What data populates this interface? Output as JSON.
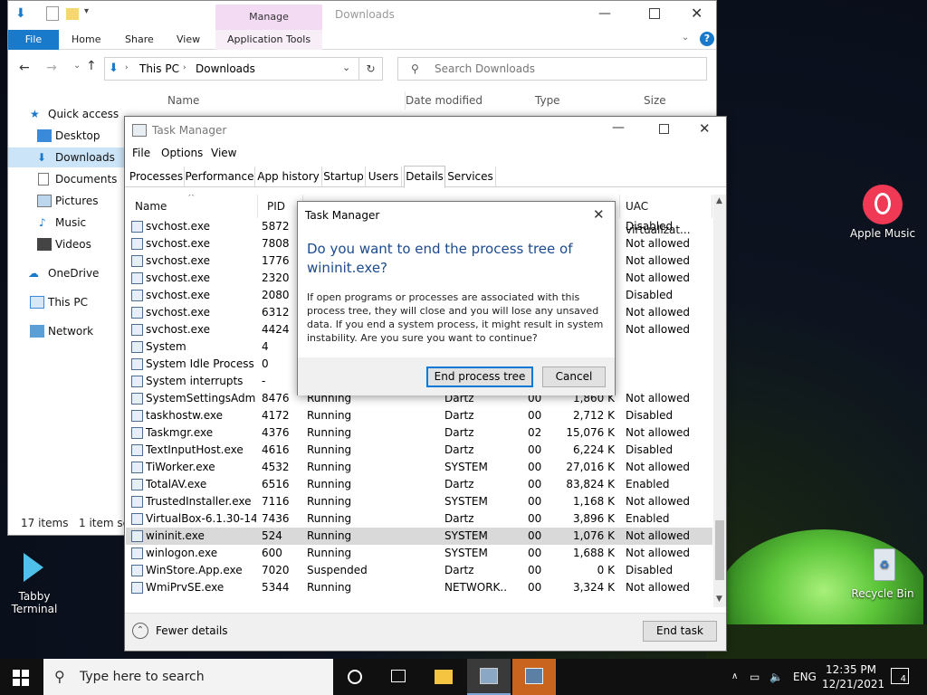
{
  "desktop": {
    "icons": [
      {
        "label": "Apple Music"
      },
      {
        "label": "Tabby Terminal"
      },
      {
        "label": "Recycle Bin"
      }
    ]
  },
  "explorer": {
    "title": "Downloads",
    "manage": "Manage",
    "tabs": [
      "File",
      "Home",
      "Share",
      "View",
      "Application Tools"
    ],
    "breadcrumb": [
      "This PC",
      "Downloads"
    ],
    "search_placeholder": "Search Downloads",
    "columns": [
      "Name",
      "Date modified",
      "Type",
      "Size"
    ],
    "nav": [
      "Quick access",
      "Desktop",
      "Downloads",
      "Documents",
      "Pictures",
      "Music",
      "Videos",
      "OneDrive",
      "This PC",
      "Network"
    ],
    "status_count": "17 items",
    "status_sel": "1 item sel"
  },
  "taskmanager": {
    "title": "Task Manager",
    "menu": [
      "File",
      "Options",
      "View"
    ],
    "tabs": [
      "Processes",
      "Performance",
      "App history",
      "Startup",
      "Users",
      "Details",
      "Services"
    ],
    "columns": [
      "Name",
      "PID",
      "UAC virtualizat..."
    ],
    "rows": [
      {
        "name": "svchost.exe",
        "pid": "5872",
        "status": "",
        "user": "",
        "cpu": "",
        "mem": "",
        "uac": "Disabled"
      },
      {
        "name": "svchost.exe",
        "pid": "7808",
        "status": "",
        "user": "",
        "cpu": "",
        "mem": "",
        "uac": "Not allowed"
      },
      {
        "name": "svchost.exe",
        "pid": "1776",
        "status": "",
        "user": "",
        "cpu": "",
        "mem": "",
        "uac": "Not allowed"
      },
      {
        "name": "svchost.exe",
        "pid": "2320",
        "status": "",
        "user": "",
        "cpu": "",
        "mem": "",
        "uac": "Not allowed"
      },
      {
        "name": "svchost.exe",
        "pid": "2080",
        "status": "",
        "user": "",
        "cpu": "",
        "mem": "",
        "uac": "Disabled"
      },
      {
        "name": "svchost.exe",
        "pid": "6312",
        "status": "",
        "user": "",
        "cpu": "",
        "mem": "",
        "uac": "Not allowed"
      },
      {
        "name": "svchost.exe",
        "pid": "4424",
        "status": "",
        "user": "",
        "cpu": "",
        "mem": "",
        "uac": "Not allowed"
      },
      {
        "name": "System",
        "pid": "4",
        "status": "",
        "user": "",
        "cpu": "",
        "mem": "",
        "uac": ""
      },
      {
        "name": "System Idle Process",
        "pid": "0",
        "status": "",
        "user": "",
        "cpu": "",
        "mem": "",
        "uac": ""
      },
      {
        "name": "System interrupts",
        "pid": "-",
        "status": "",
        "user": "",
        "cpu": "",
        "mem": "",
        "uac": ""
      },
      {
        "name": "SystemSettingsAdmi...",
        "pid": "8476",
        "status": "Running",
        "user": "Dartz",
        "cpu": "00",
        "mem": "1,860 K",
        "uac": "Not allowed"
      },
      {
        "name": "taskhostw.exe",
        "pid": "4172",
        "status": "Running",
        "user": "Dartz",
        "cpu": "00",
        "mem": "2,712 K",
        "uac": "Disabled"
      },
      {
        "name": "Taskmgr.exe",
        "pid": "4376",
        "status": "Running",
        "user": "Dartz",
        "cpu": "02",
        "mem": "15,076 K",
        "uac": "Not allowed"
      },
      {
        "name": "TextInputHost.exe",
        "pid": "4616",
        "status": "Running",
        "user": "Dartz",
        "cpu": "00",
        "mem": "6,224 K",
        "uac": "Disabled"
      },
      {
        "name": "TiWorker.exe",
        "pid": "4532",
        "status": "Running",
        "user": "SYSTEM",
        "cpu": "00",
        "mem": "27,016 K",
        "uac": "Not allowed"
      },
      {
        "name": "TotalAV.exe",
        "pid": "6516",
        "status": "Running",
        "user": "Dartz",
        "cpu": "00",
        "mem": "83,824 K",
        "uac": "Enabled"
      },
      {
        "name": "TrustedInstaller.exe",
        "pid": "7116",
        "status": "Running",
        "user": "SYSTEM",
        "cpu": "00",
        "mem": "1,168 K",
        "uac": "Not allowed"
      },
      {
        "name": "VirtualBox-6.1.30-14...",
        "pid": "7436",
        "status": "Running",
        "user": "Dartz",
        "cpu": "00",
        "mem": "3,896 K",
        "uac": "Enabled"
      },
      {
        "name": "wininit.exe",
        "pid": "524",
        "status": "Running",
        "user": "SYSTEM",
        "cpu": "00",
        "mem": "1,076 K",
        "uac": "Not allowed"
      },
      {
        "name": "winlogon.exe",
        "pid": "600",
        "status": "Running",
        "user": "SYSTEM",
        "cpu": "00",
        "mem": "1,688 K",
        "uac": "Not allowed"
      },
      {
        "name": "WinStore.App.exe",
        "pid": "7020",
        "status": "Suspended",
        "user": "Dartz",
        "cpu": "00",
        "mem": "0 K",
        "uac": "Disabled"
      },
      {
        "name": "WmiPrvSE.exe",
        "pid": "5344",
        "status": "Running",
        "user": "NETWORK...",
        "cpu": "00",
        "mem": "3,324 K",
        "uac": "Not allowed"
      }
    ],
    "selected_row": 18,
    "fewer_details": "Fewer details",
    "end_task": "End task"
  },
  "dialog": {
    "title": "Task Manager",
    "heading": "Do you want to end the process tree of wininit.exe?",
    "body": "If open programs or processes are associated with this process tree, they will close and you will lose any unsaved data. If you end a system process, it might result in system instability. Are you sure you want to continue?",
    "primary": "End process tree",
    "cancel": "Cancel"
  },
  "taskbar": {
    "search_placeholder": "Type here to search",
    "lang": "ENG",
    "time": "12:35 PM",
    "date": "12/21/2021",
    "notifications": "4"
  }
}
